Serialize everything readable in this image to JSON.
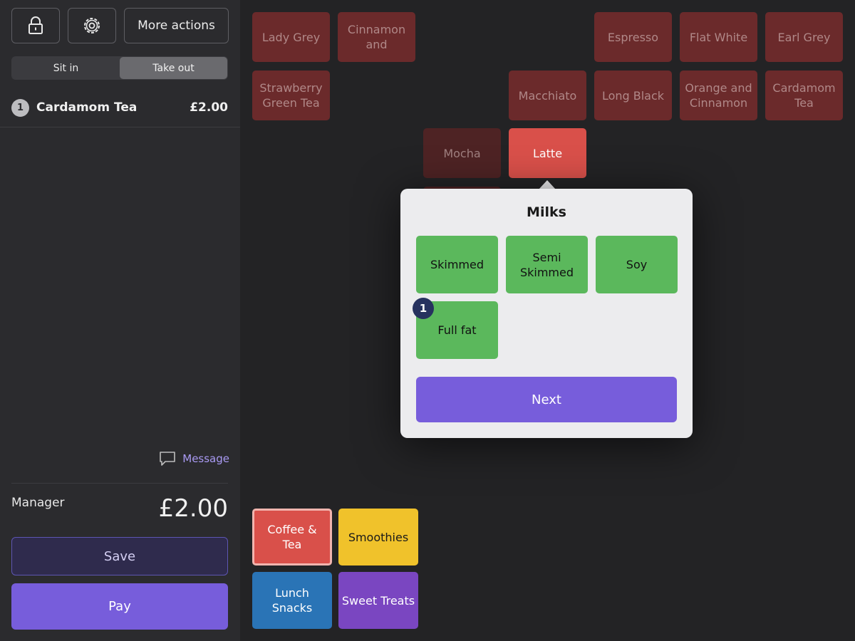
{
  "toolbar": {
    "lock_icon": "lock-icon",
    "settings_icon": "gear-icon",
    "more_actions_label": "More actions"
  },
  "order_type": {
    "options": [
      "Sit in",
      "Take out"
    ],
    "selected": "Take out"
  },
  "order": {
    "lines": [
      {
        "qty": "1",
        "name": "Cardamom Tea",
        "price": "£2.00"
      }
    ],
    "message_label": "Message",
    "staff": "Manager",
    "total": "£2.00",
    "save_label": "Save",
    "pay_label": "Pay"
  },
  "products": {
    "row1": [
      "Lady Grey",
      "Cinnamon and",
      "Espresso",
      "Flat White",
      "Earl Grey"
    ],
    "row2": [
      "Strawberry Green Tea",
      "Macchiato",
      "Long Black",
      "Orange and Cinnamon",
      "Cardamom Tea"
    ],
    "row3": [
      "Mocha",
      "Latte"
    ],
    "selected": "Latte"
  },
  "milks_popover": {
    "title": "Milks",
    "options": [
      "Skimmed",
      "Semi Skimmed",
      "Soy",
      "Full fat"
    ],
    "selected_badge": "1",
    "next_label": "Next"
  },
  "categories": [
    {
      "label": "Coffee & Tea",
      "color": "#d9504a"
    },
    {
      "label": "Smoothies",
      "color": "#f0c22b"
    },
    {
      "label": "Lunch Snacks",
      "color": "#2a74b6"
    },
    {
      "label": "Sweet Treats",
      "color": "#7a46c1"
    }
  ],
  "colors": {
    "accent": "#775ddb",
    "milk_green": "#5bb85c",
    "product_red": "#6b2a2b"
  }
}
